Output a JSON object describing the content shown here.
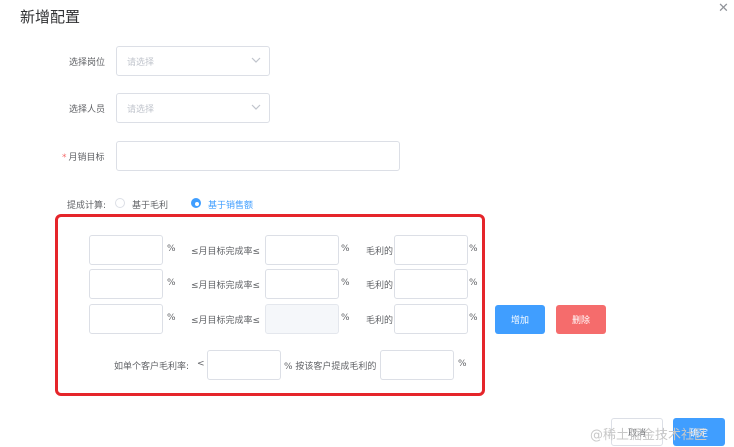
{
  "dialog": {
    "title": "新增配置"
  },
  "form": {
    "position": {
      "label": "选择岗位",
      "placeholder": "请选择"
    },
    "person": {
      "label": "选择人员",
      "placeholder": "请选择"
    },
    "monthly_target": {
      "required_mark": "*",
      "label": "月销目标",
      "value": ""
    },
    "commission": {
      "label": "提成计算:",
      "options": [
        "基于毛利",
        "基于销售额"
      ],
      "selected": "基于销售额"
    },
    "tiers": {
      "rows": [
        {
          "min": "",
          "min_unit": "%",
          "condition": "≤月目标完成率≤",
          "max": "",
          "max_unit": "%",
          "rate_label": "毛利的",
          "rate": "",
          "rate_unit": "%"
        },
        {
          "min": "",
          "min_unit": "%",
          "condition": "≤月目标完成率≤",
          "max": "",
          "max_unit": "%",
          "rate_label": "毛利的",
          "rate": "",
          "rate_unit": "%"
        },
        {
          "min": "",
          "min_unit": "%",
          "condition": "≤月目标完成率≤",
          "max": "",
          "max_unit": "%",
          "rate_label": "毛利的",
          "rate": "",
          "rate_unit": "%"
        }
      ],
      "add_label": "增加",
      "delete_label": "删除"
    },
    "single_customer": {
      "prefix": "如单个客户毛利率:",
      "comparator": "<",
      "value": "",
      "middle": "% 按该客户提成毛利的",
      "rate": "",
      "suffix": "%"
    }
  },
  "footer": {
    "cancel_label": "取消",
    "confirm_label": "确定"
  },
  "watermark": "@稀土掘金技术社区",
  "colors": {
    "primary": "#409eff",
    "danger": "#f56c6c",
    "highlight_box": "#e5252a"
  }
}
